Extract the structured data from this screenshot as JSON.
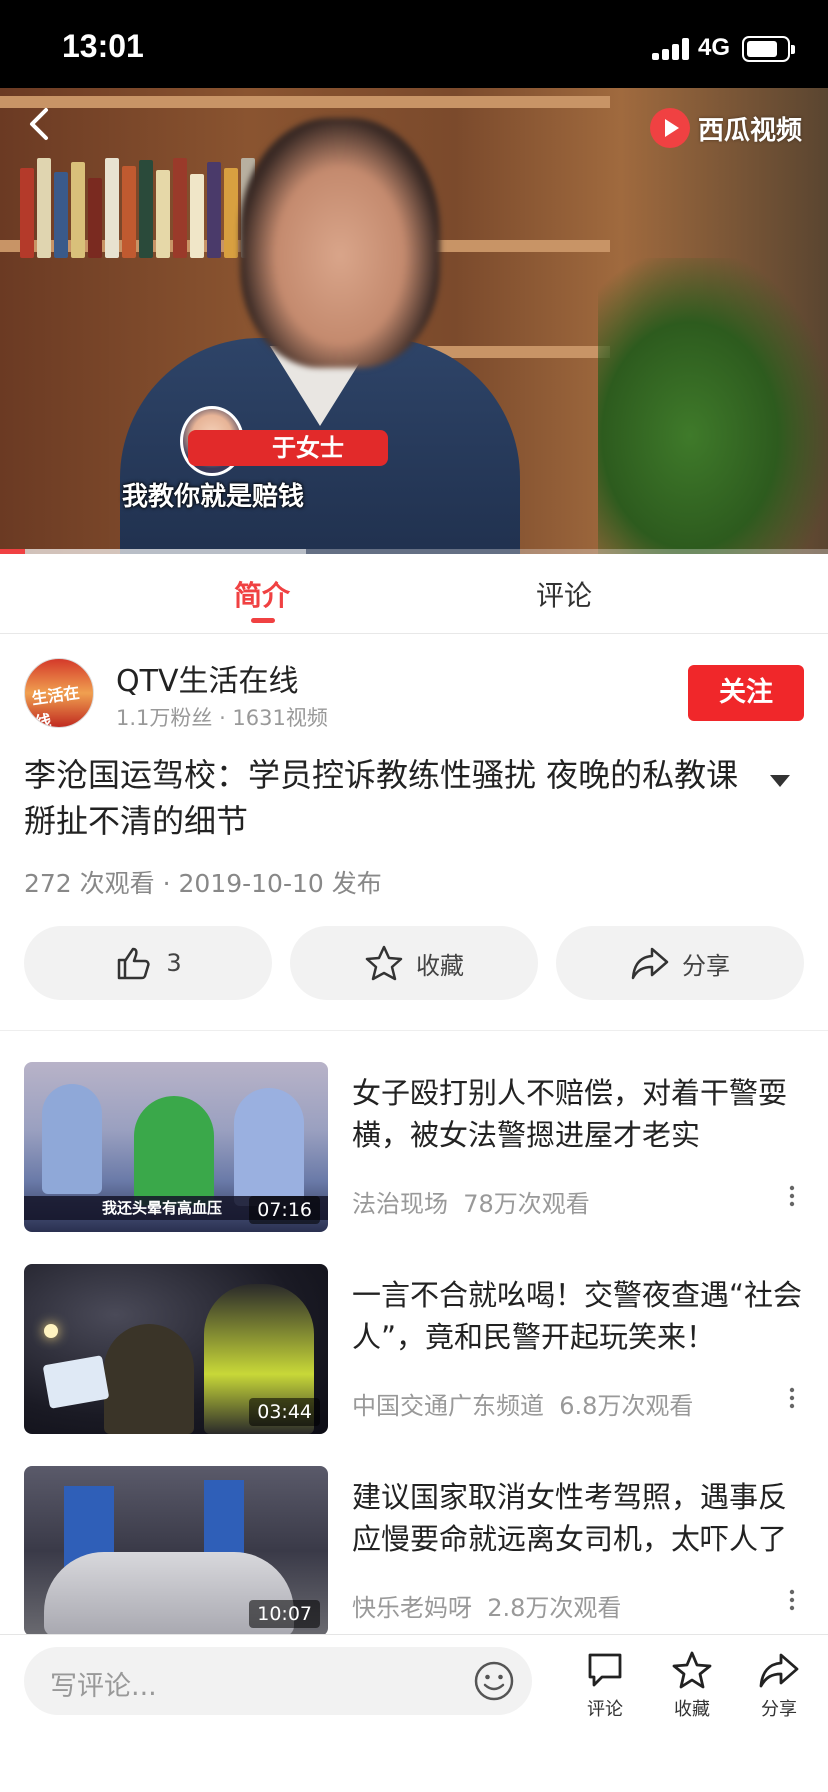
{
  "status_bar": {
    "time": "13:01",
    "network": "4G"
  },
  "player": {
    "brand_name": "西瓜视频",
    "name_tag": "于女士",
    "subtitle": "我教你就是赔钱",
    "progress": 0.03,
    "buffered": 0.37
  },
  "tabs": [
    {
      "label": "简介",
      "active": true
    },
    {
      "label": "评论",
      "active": false
    }
  ],
  "author": {
    "avatar_text": "生活在线",
    "name": "QTV生活在线",
    "stats": "1.1万粉丝 · 1631视频",
    "follow_label": "关注"
  },
  "video": {
    "title": "李沧国运驾校：学员控诉教练性骚扰 夜晚的私教课 掰扯不清的细节",
    "meta": "272 次观看 · 2019-10-10 发布"
  },
  "actions": {
    "like_count": "3",
    "favorite_label": "收藏",
    "share_label": "分享"
  },
  "related": [
    {
      "title": "女子殴打别人不赔偿，对着干警耍横，被女法警摁进屋才老实",
      "source": "法治现场",
      "views": "78万次观看",
      "duration": "07:16",
      "thumb_caption": "我还头晕有高血压"
    },
    {
      "title": "一言不合就吆喝！交警夜查遇“社会人”，竟和民警开起玩笑来！",
      "source": "中国交通广东频道",
      "views": "6.8万次观看",
      "duration": "03:44"
    },
    {
      "title": "建议国家取消女性考驾照，遇事反应慢要命就远离女司机，太吓人了",
      "source": "快乐老妈呀",
      "views": "2.8万次观看",
      "duration": "10:07"
    }
  ],
  "bottom_bar": {
    "comment_placeholder": "写评论...",
    "comment_label": "评论",
    "favorite_label": "收藏",
    "share_label": "分享"
  },
  "colors": {
    "accent": "#f04142",
    "follow": "#f0272a"
  }
}
